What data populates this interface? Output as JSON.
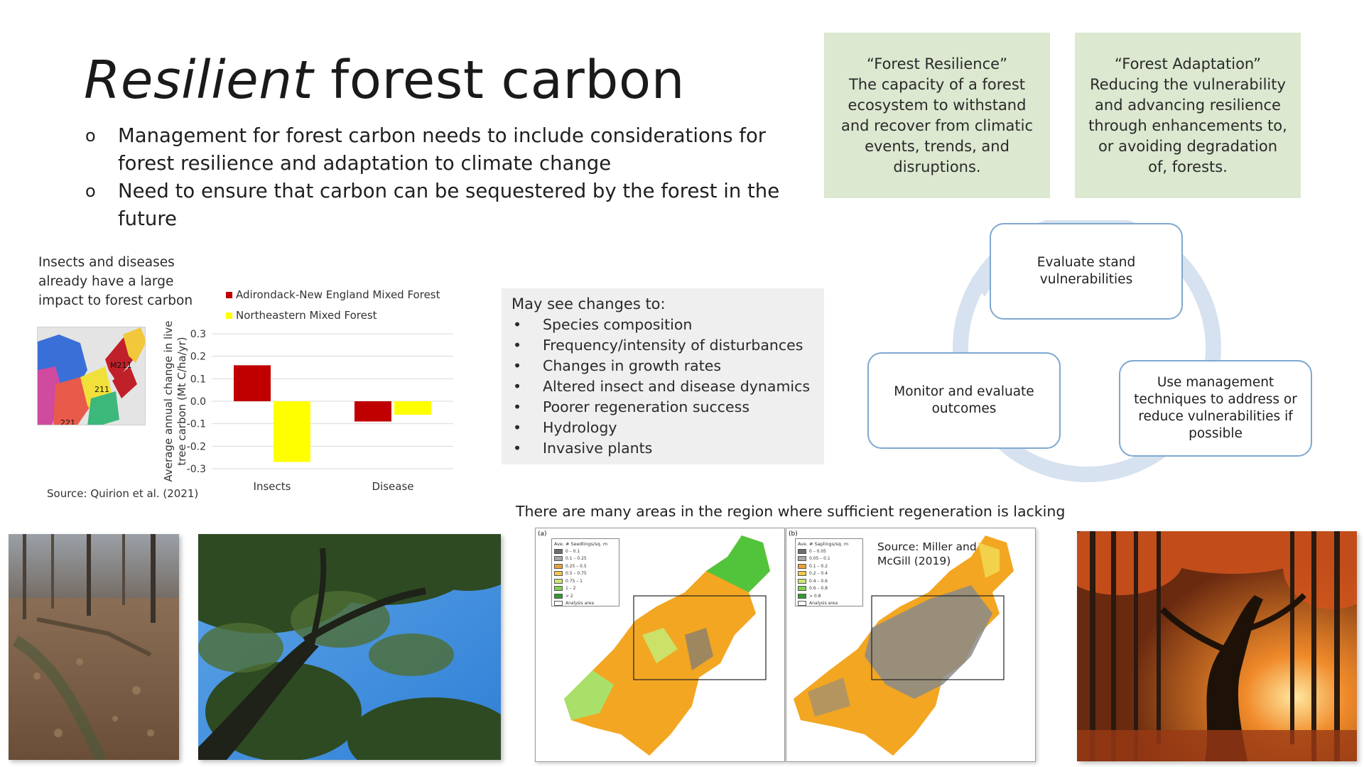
{
  "slide": {
    "title_italic": "Resilient",
    "title_rest": " forest carbon",
    "bullet_marker": "o",
    "bullets": [
      "Management for forest carbon needs to include considerations for forest resilience and adaptation to climate change",
      "Need to ensure that carbon can be sequestered by the forest in the future"
    ]
  },
  "definitions": [
    {
      "heading": "“Forest Resilience”",
      "body": "The capacity of a forest ecosystem to withstand and recover from climatic events, trends, and disruptions."
    },
    {
      "heading": "“Forest Adaptation”",
      "body": "Reducing the vulnerability and advancing resilience through enhancements to, or avoiding degradation of, forests."
    }
  ],
  "insects_note": "Insects and diseases already have a large impact to forest carbon",
  "minimap_labels": [
    "M211",
    "211",
    "221"
  ],
  "source_quirion": "Source: Quirion et al. (2021)",
  "chart_data": {
    "type": "bar",
    "categories": [
      "Insects",
      "Disease"
    ],
    "series": [
      {
        "name": "Adirondack-New England Mixed Forest",
        "color": "#c00000",
        "values": [
          0.16,
          -0.09
        ]
      },
      {
        "name": "Northeastern Mixed Forest",
        "color": "#ffff00",
        "values": [
          -0.27,
          -0.06
        ]
      }
    ],
    "ylabel": "Average annual change in live tree carbon (Mt C/ha/yr)",
    "ylim": [
      -0.3,
      0.3
    ],
    "yticks": [
      0.3,
      0.2,
      0.1,
      0.0,
      -0.1,
      -0.2,
      -0.3
    ],
    "ytick_labels": [
      "0.3",
      "0.2",
      "0.1",
      "0.0",
      "-0.1",
      "-0.2",
      "-0.3"
    ],
    "grid": true,
    "legend_position": "top-left"
  },
  "changes": {
    "heading": "May see changes to:",
    "bullet": "•",
    "items": [
      "Species composition",
      "Frequency/intensity of disturbances",
      "Changes in growth rates",
      "Altered insect and disease dynamics",
      "Poorer regeneration success",
      "Hydrology",
      "Invasive plants"
    ]
  },
  "cycle": {
    "evaluate": "Evaluate stand vulnerabilities",
    "use": "Use management techniques to address or reduce vulnerabilities if possible",
    "monitor": "Monitor and evaluate outcomes"
  },
  "regen_caption": "There are many areas in the region where sufficient regeneration is lacking",
  "regen_maps": {
    "panel_a_label": "(a)",
    "panel_b_label": "(b)",
    "legend_a_title": "Ave. # Seedlings/sq. m",
    "legend_b_title": "Ave. # Saplings/sq. m",
    "legend_a_items": [
      "0 – 0.1",
      "0.1 – 0.25",
      "0.25 – 0.5",
      "0.5 – 0.75",
      "0.75 – 1",
      "1 – 2",
      "> 2",
      "Analysis area"
    ],
    "legend_b_items": [
      "0 – 0.05",
      "0.05 – 0.1",
      "0.1 – 0.2",
      "0.2 – 0.4",
      "0.4 – 0.6",
      "0.6 – 0.8",
      "> 0.8",
      "Analysis area"
    ],
    "legend_colors": [
      "#6e6e6e",
      "#a8a8a8",
      "#e8a13a",
      "#f2c84b",
      "#c8e870",
      "#7fd04a",
      "#2e9c2e",
      "#ffffff"
    ],
    "source": "Source: Miller and McGill (2019)"
  }
}
